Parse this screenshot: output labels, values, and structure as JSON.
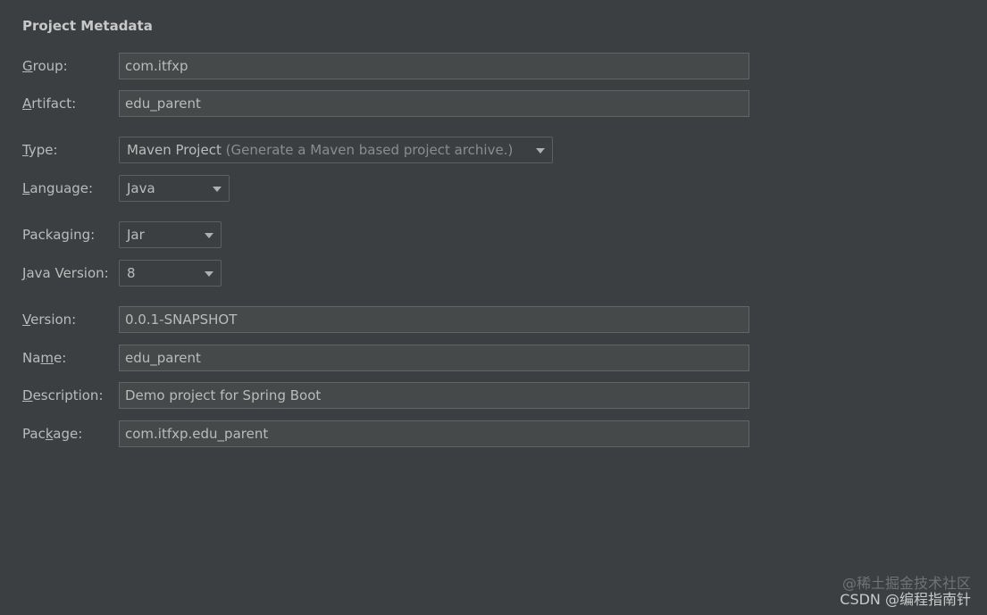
{
  "section": {
    "title": "Project Metadata"
  },
  "fields": {
    "group": {
      "label_mn": "G",
      "label_rest": "roup:",
      "value": "com.itfxp"
    },
    "artifact": {
      "label_mn": "A",
      "label_rest": "rtifact:",
      "value": "edu_parent"
    },
    "type": {
      "label_mn": "T",
      "label_rest": "ype:",
      "value": "Maven Project",
      "hint": "(Generate a Maven based project archive.)"
    },
    "language": {
      "label_mn": "L",
      "label_rest": "anguage:",
      "value": "Java"
    },
    "packaging": {
      "label": "Packaging:",
      "value": "Jar"
    },
    "java_version": {
      "label_mn": "J",
      "label_rest": "ava Version:",
      "value": "8"
    },
    "version": {
      "label_mn": "V",
      "label_rest": "ersion:",
      "value": "0.0.1-SNAPSHOT"
    },
    "name": {
      "label_pre": "Na",
      "label_mn": "m",
      "label_rest": "e:",
      "value": "edu_parent"
    },
    "description": {
      "label_mn": "D",
      "label_rest": "escription:",
      "value": "Demo project for Spring Boot"
    },
    "package": {
      "label_pre": "Pac",
      "label_mn": "k",
      "label_rest": "age:",
      "value": "com.itfxp.edu_parent"
    }
  },
  "watermark": {
    "line1": "@稀土掘金技术社区",
    "line2": "CSDN @编程指南针"
  }
}
